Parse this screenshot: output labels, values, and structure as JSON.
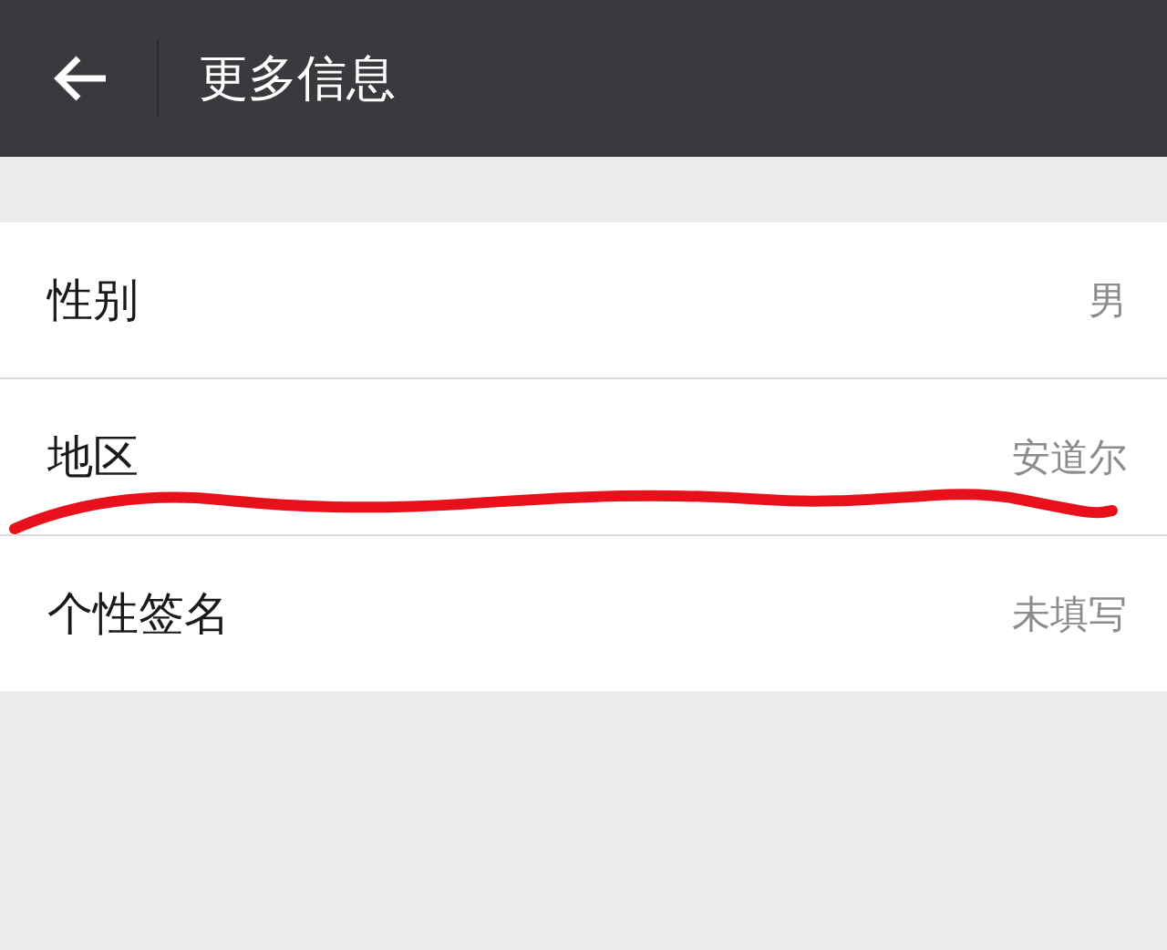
{
  "header": {
    "title": "更多信息"
  },
  "rows": [
    {
      "label": "性别",
      "value": "男"
    },
    {
      "label": "地区",
      "value": "安道尔"
    },
    {
      "label": "个性签名",
      "value": "未填写"
    }
  ]
}
